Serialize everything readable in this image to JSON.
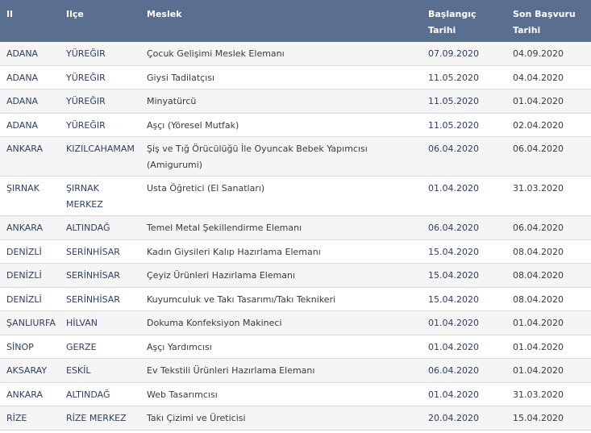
{
  "table": {
    "headers": {
      "il": "Il",
      "ilce": "Ilçe",
      "meslek": "Meslek",
      "baslangic": "Başlangıç Tarihi",
      "son_basvuru": "Son Başvuru Tarihi"
    },
    "rows": [
      {
        "il": "ADANA",
        "ilce": "YÜREĞIR",
        "meslek": "Çocuk Gelişimi Meslek Elemanı",
        "baslangic": "07.09.2020",
        "son": "04.09.2020"
      },
      {
        "il": "ADANA",
        "ilce": "YÜREĞIR",
        "meslek": "Giysi Tadilatçısı",
        "baslangic": "11.05.2020",
        "son": "04.04.2020"
      },
      {
        "il": "ADANA",
        "ilce": "YÜREĞIR",
        "meslek": "Minyatürcü",
        "baslangic": "11.05.2020",
        "son": "01.04.2020"
      },
      {
        "il": "ADANA",
        "ilce": "YÜREĞIR",
        "meslek": "Aşçı (Yöresel Mutfak)",
        "baslangic": "11.05.2020",
        "son": "02.04.2020"
      },
      {
        "il": "ANKARA",
        "ilce": "KIZILCAHAMAM",
        "meslek": "Şiş ve Tığ Örücülüğü İle Oyuncak Bebek Yapımcısı (Amigurumi)",
        "baslangic": "06.04.2020",
        "son": "06.04.2020"
      },
      {
        "il": "ŞIRNAK",
        "ilce": "ŞIRNAK MERKEZ",
        "meslek": "Usta Öğretici (El Sanatları)",
        "baslangic": "01.04.2020",
        "son": "31.03.2020"
      },
      {
        "il": "ANKARA",
        "ilce": "ALTINDAĞ",
        "meslek": "Temel Metal Şekillendirme Elemanı",
        "baslangic": "06.04.2020",
        "son": "06.04.2020"
      },
      {
        "il": "DENİZLİ",
        "ilce": "SERİNHİSAR",
        "meslek": "Kadın Giysileri Kalıp Hazırlama Elemanı",
        "baslangic": "15.04.2020",
        "son": "08.04.2020"
      },
      {
        "il": "DENİZLİ",
        "ilce": "SERİNHİSAR",
        "meslek": "Çeyiz Ürünleri Hazırlama Elemanı",
        "baslangic": "15.04.2020",
        "son": "08.04.2020"
      },
      {
        "il": "DENİZLİ",
        "ilce": "SERİNHİSAR",
        "meslek": "Kuyumculuk ve Takı Tasarımı/Takı Teknikeri",
        "baslangic": "15.04.2020",
        "son": "08.04.2020"
      },
      {
        "il": "ŞANLIURFA",
        "ilce": "HİLVAN",
        "meslek": "Dokuma Konfeksiyon Makineci",
        "baslangic": "01.04.2020",
        "son": "01.04.2020"
      },
      {
        "il": "SİNOP",
        "ilce": "GERZE",
        "meslek": "Aşçı Yardımcısı",
        "baslangic": "01.04.2020",
        "son": "01.04.2020"
      },
      {
        "il": "AKSARAY",
        "ilce": "ESKİL",
        "meslek": "Ev Tekstili Ürünleri Hazırlama Elemanı",
        "baslangic": "06.04.2020",
        "son": "01.04.2020"
      },
      {
        "il": "ANKARA",
        "ilce": "ALTINDAĞ",
        "meslek": "Web Tasarımcısı",
        "baslangic": "01.04.2020",
        "son": "31.03.2020"
      },
      {
        "il": "RİZE",
        "ilce": "RİZE MERKEZ",
        "meslek": "Takı Çizimi ve Üreticisi",
        "baslangic": "20.04.2020",
        "son": "15.04.2020"
      }
    ]
  },
  "colors": {
    "header_bg": "#5a6f8f",
    "header_text": "#ffffff",
    "row_odd": "#f5f5f5",
    "row_even": "#ffffff",
    "link_text": "#2d3f61"
  }
}
